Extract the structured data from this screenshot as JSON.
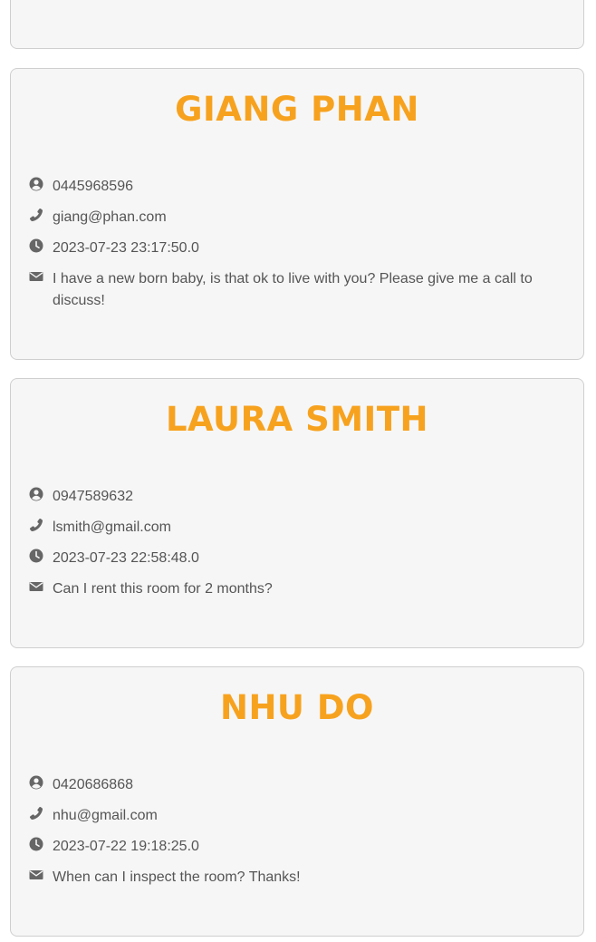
{
  "colors": {
    "accent": "#f7a21e",
    "card_background": "#f6f6f6",
    "card_border": "#cfcfcf",
    "text": "#555555",
    "icon": "#666666"
  },
  "icons": {
    "contact": "user-circle-icon",
    "email": "phone-icon",
    "time": "clock-icon",
    "message": "envelope-icon"
  },
  "enquiries": [
    {
      "name": "GIANG PHAN",
      "phone": "0445968596",
      "email": "giang@phan.com",
      "date": "2023-07-23 23:17:50.0",
      "message": "I have a new born baby, is that ok to live with you? Please give me a call to discuss!"
    },
    {
      "name": "LAURA SMITH",
      "phone": "0947589632",
      "email": "lsmith@gmail.com",
      "date": "2023-07-23 22:58:48.0",
      "message": "Can I rent this room for 2 months?"
    },
    {
      "name": "NHU DO",
      "phone": "0420686868",
      "email": "nhu@gmail.com",
      "date": "2023-07-22 19:18:25.0",
      "message": "When can I inspect the room? Thanks!"
    }
  ]
}
